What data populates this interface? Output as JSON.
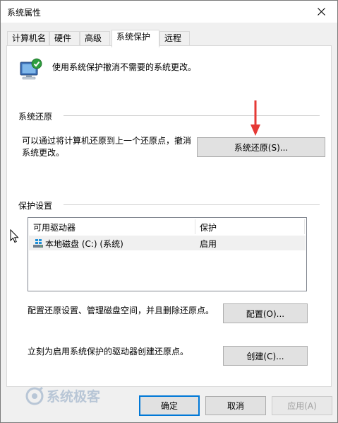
{
  "window": {
    "title": "系统属性",
    "close_glyph": "✕"
  },
  "tabs": [
    {
      "label": "计算机名",
      "active": false
    },
    {
      "label": "硬件",
      "active": false
    },
    {
      "label": "高级",
      "active": false
    },
    {
      "label": "系统保护",
      "active": true
    },
    {
      "label": "远程",
      "active": false
    }
  ],
  "intro": {
    "text": "使用系统保护撤消不需要的系统更改。",
    "icon": "computer-shield-icon"
  },
  "restore": {
    "section_label": "系统还原",
    "description_line1": "可以通过将计算机还原到上一个还原点，撤消",
    "description_line2": "系统更改。",
    "button": "系统还原(S)..."
  },
  "protection": {
    "section_label": "保护设置",
    "columns": [
      "可用驱动器",
      "保护"
    ],
    "rows": [
      {
        "drive": "本地磁盘 (C:) (系统)",
        "status": "启用"
      }
    ],
    "configure_text": "配置还原设置、管理磁盘空间，并且删除还原点。",
    "configure_button": "配置(O)...",
    "create_text": "立刻为启用系统保护的驱动器创建还原点。",
    "create_button": "创建(C)..."
  },
  "footer": {
    "ok": "确定",
    "cancel": "取消",
    "apply": "应用(A)"
  },
  "watermark": {
    "text": "系统极客"
  },
  "colors": {
    "accent_border": "#0078d7",
    "arrow": "#e53935",
    "panel_bg": "#ffffff",
    "window_bg": "#f0f0f0"
  }
}
